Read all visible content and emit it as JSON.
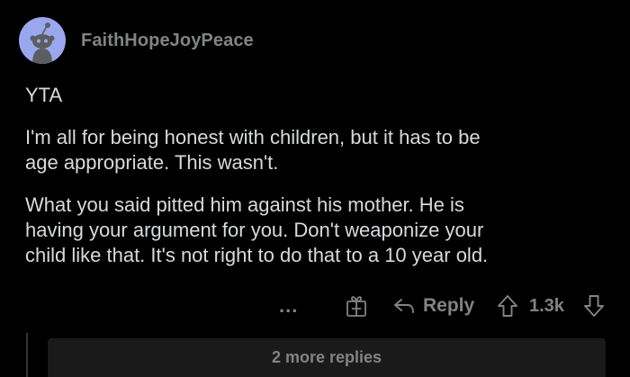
{
  "comment": {
    "username": "FaithHopeJoyPeace",
    "paragraphs": [
      "YTA",
      "I'm all for being honest with children, but it has to be\nage appropriate. This wasn't.",
      "What you said pitted him against his mother. He is\nhaving your argument for you. Don't weaponize your\nchild like that. It's not right to do that to a 10 year old."
    ],
    "actions": {
      "more": "...",
      "reply_label": "Reply",
      "vote_count": "1.3k"
    },
    "more_replies_label": "2 more replies"
  },
  "colors": {
    "background": "#000000",
    "text": "#d7dadc",
    "muted": "#818384",
    "avatar": "#9aa7ee",
    "panel": "#1a1a1b"
  },
  "icons": {
    "avatar": "snoo-avatar-icon",
    "award": "gift-award-icon",
    "reply": "reply-arrow-icon",
    "upvote": "upvote-arrow-icon",
    "downvote": "downvote-arrow-icon"
  }
}
